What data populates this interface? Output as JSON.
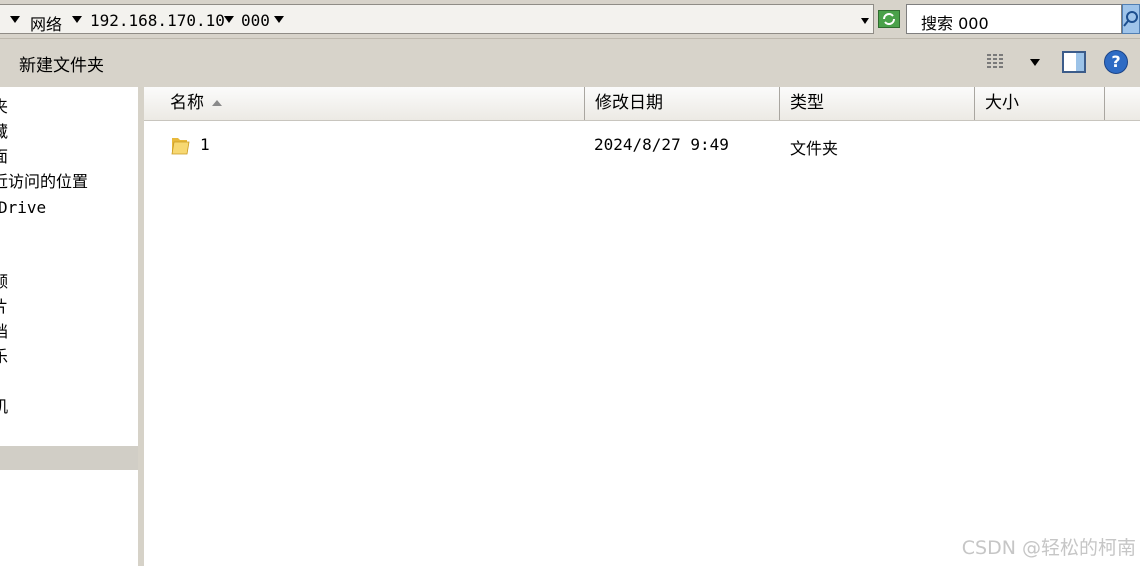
{
  "address_bar": {
    "crumbs": [
      "网络",
      "192.168.170.10",
      "000"
    ]
  },
  "search": {
    "value": "搜索 000"
  },
  "toolbar": {
    "new_folder_label": "新建文件夹",
    "icons": [
      "views-icon",
      "chevron-down-icon",
      "preview-pane-icon",
      "help-icon"
    ],
    "help_glyph": "?"
  },
  "nav": {
    "items": [
      "夹",
      "藏",
      "面",
      "近访问的位置",
      "Drive",
      "频",
      "片",
      "档",
      "乐",
      "机"
    ]
  },
  "columns": [
    {
      "label": "名称",
      "sorted": "ascending"
    },
    {
      "label": "修改日期"
    },
    {
      "label": "类型"
    },
    {
      "label": "大小"
    }
  ],
  "files": [
    {
      "name": "1",
      "modified": "2024/8/27 9:49",
      "type": "文件夹",
      "size": ""
    }
  ],
  "watermark": "CSDN @轻松的柯南",
  "colors": {
    "window_bg": "#d6d2c8",
    "folder": "#f2cf5b",
    "refresh": "#4aa14a",
    "help": "#2e6bc4"
  }
}
